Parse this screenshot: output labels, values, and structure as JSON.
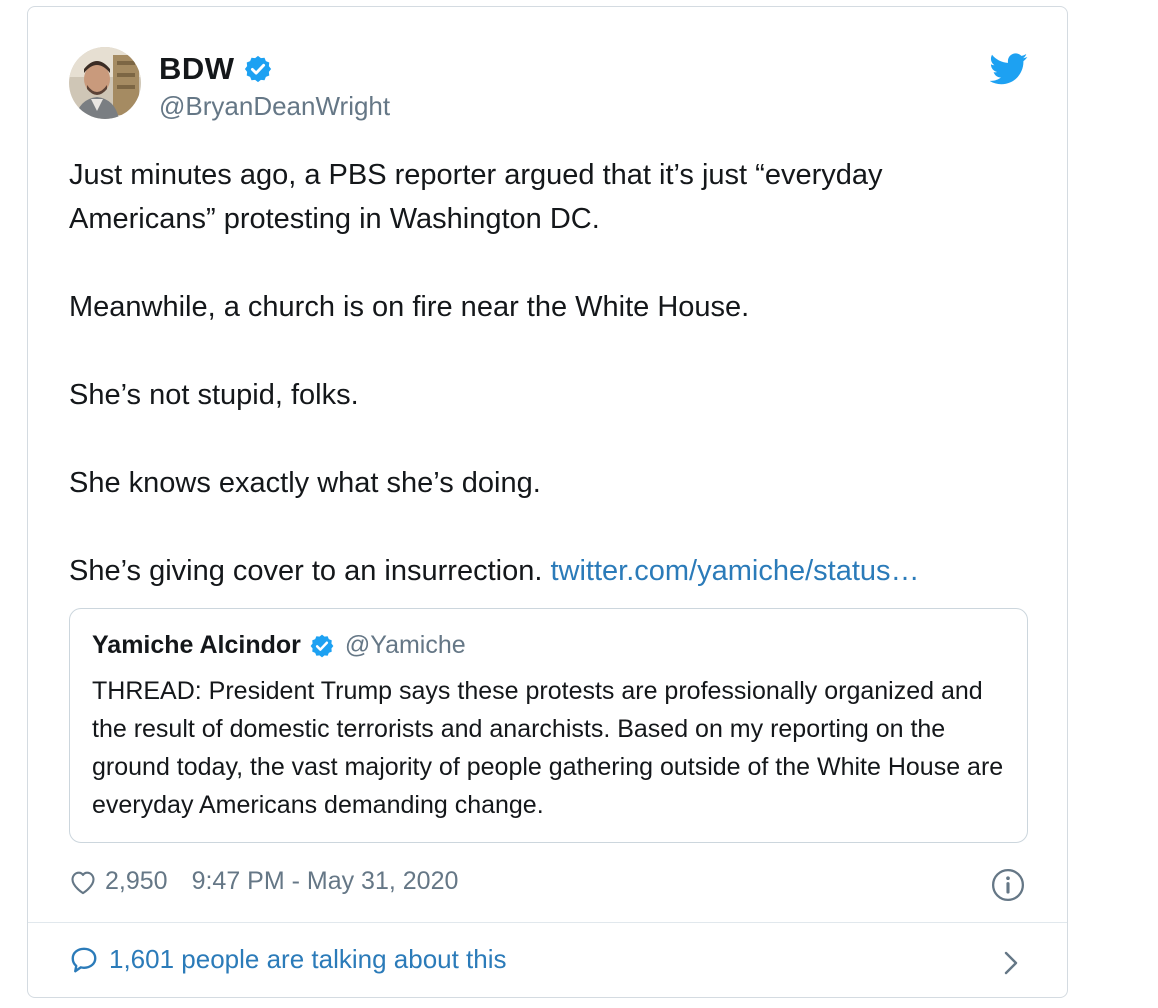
{
  "author": {
    "name": "BDW",
    "handle": "@BryanDeanWright"
  },
  "tweet": {
    "paragraphs": [
      "Just minutes ago, a PBS reporter argued that it’s just “everyday Americans” protesting in Washington DC.",
      "Meanwhile, a church is on fire near the White House.",
      "She’s not stupid, folks.",
      "She knows exactly what she’s doing.",
      "She’s giving cover to an insurrection."
    ],
    "link_text": "twitter.com/yamiche/status…"
  },
  "quoted": {
    "name": "Yamiche Alcindor",
    "handle": "@Yamiche",
    "text": "THREAD: President Trump says these protests are professionally organized and the result of domestic terrorists and anarchists. Based on my reporting on the ground today, the vast majority of people gathering outside of the White House are everyday Americans demanding change."
  },
  "meta": {
    "likes": "2,950",
    "timestamp": "9:47 PM - May 31, 2020"
  },
  "footer": {
    "talking": "1,601 people are talking about this"
  },
  "colors": {
    "link": "#2b7bb9",
    "verified": "#1da1f2",
    "secondary_text": "#657786",
    "primary_text": "#14171a"
  },
  "icons": [
    "verified-badge-icon",
    "twitter-bird-icon",
    "heart-icon",
    "info-icon",
    "speech-bubble-icon",
    "chevron-right-icon"
  ]
}
